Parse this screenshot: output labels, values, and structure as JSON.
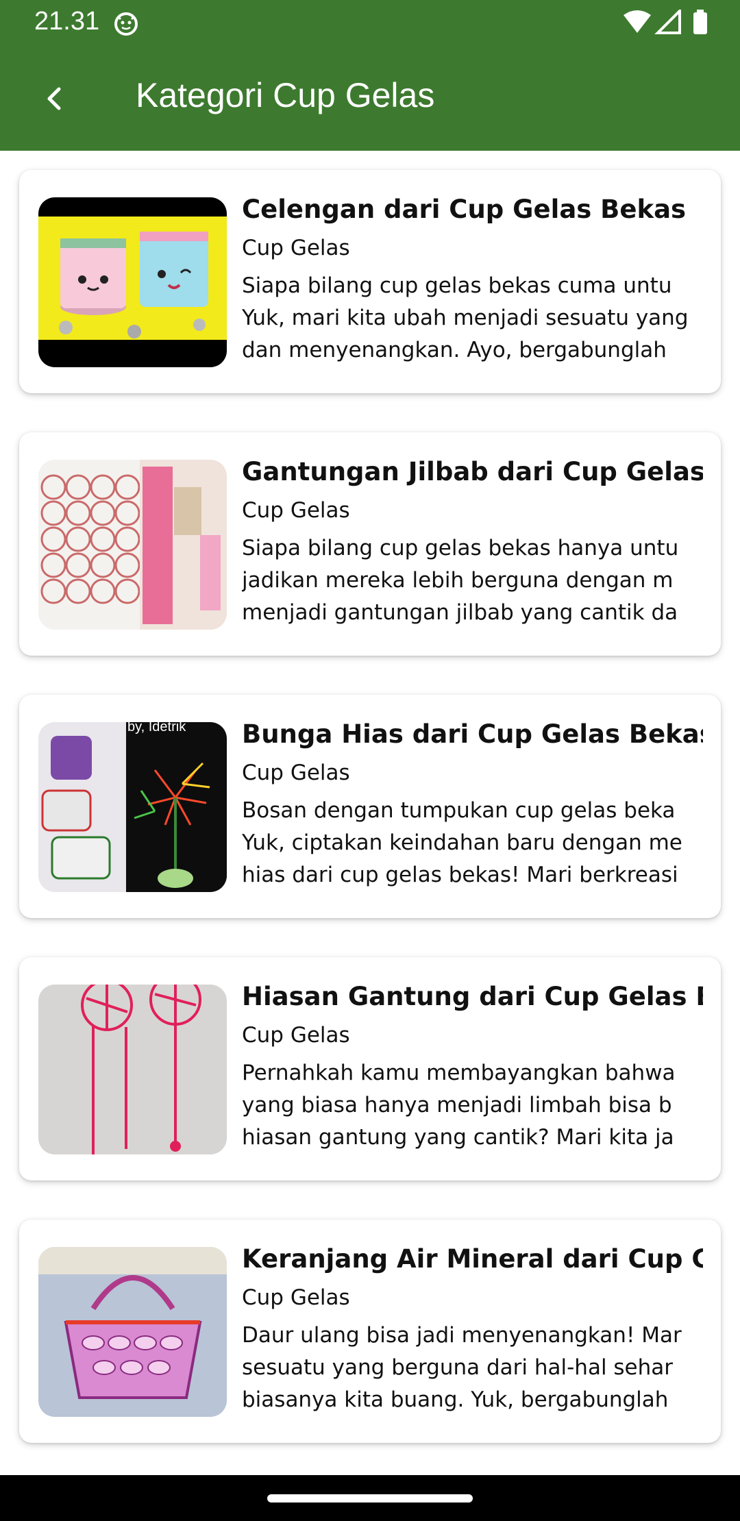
{
  "status_bar": {
    "time": "21.31",
    "icons": [
      "app-face-icon",
      "wifi-icon",
      "signal-icon",
      "battery-icon"
    ]
  },
  "app_bar": {
    "title": "Kategori Cup Gelas",
    "back_icon": "back-arrow-icon",
    "background": "#3d7a2f"
  },
  "articles": [
    {
      "title": "Celengan dari Cup Gelas Bekas",
      "category": "Cup Gelas",
      "desc_lines": [
        "Siapa bilang cup gelas bekas cuma untu",
        "Yuk, mari kita ubah menjadi sesuatu yang",
        "dan menyenangkan. Ayo, bergabunglah"
      ]
    },
    {
      "title": "Gantungan Jilbab dari Cup Gelas Bekas",
      "category": "Cup Gelas",
      "desc_lines": [
        "Siapa bilang cup gelas bekas hanya untu",
        "jadikan mereka lebih berguna dengan m",
        "menjadi gantungan jilbab yang cantik da"
      ]
    },
    {
      "title": "Bunga Hias dari Cup Gelas Bekas",
      "category": "Cup Gelas",
      "image_caption": "by, Idetrik",
      "desc_lines": [
        "Bosan dengan tumpukan cup gelas beka",
        "Yuk, ciptakan keindahan baru dengan me",
        "hias dari cup gelas bekas! Mari berkreasi"
      ]
    },
    {
      "title": "Hiasan Gantung dari Cup Gelas Bekas",
      "category": "Cup Gelas",
      "desc_lines": [
        "Pernahkah kamu membayangkan bahwa",
        "yang biasa hanya menjadi limbah bisa b",
        "hiasan gantung yang cantik? Mari kita ja"
      ]
    },
    {
      "title": "Keranjang Air Mineral dari Cup Gelas",
      "category": "Cup Gelas",
      "desc_lines": [
        "Daur ulang bisa jadi menyenangkan! Mar",
        "sesuatu yang berguna dari hal-hal sehar",
        "biasanya kita buang. Yuk, bergabunglah"
      ]
    }
  ]
}
